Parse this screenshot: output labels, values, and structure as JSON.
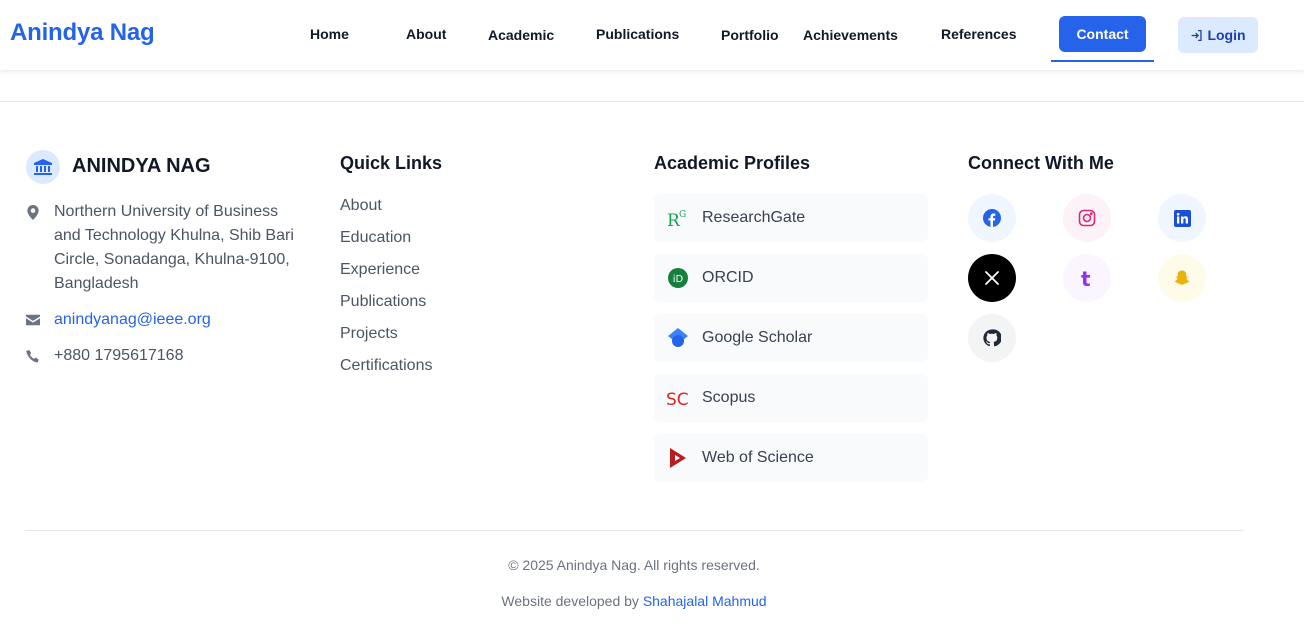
{
  "header": {
    "brand": "Anindya Nag",
    "nav": [
      "Home",
      "About",
      "Academic",
      "Publications",
      "Portfolio",
      "Achievements",
      "References"
    ],
    "contact": "Contact",
    "login": "Login"
  },
  "org": {
    "name": "ANINDYA NAG",
    "address": "Northern University of Business and Technology Khulna, Shib Bari Circle, Sonadanga, Khulna-9100, Bangladesh",
    "email": "anindyanag@ieee.org",
    "phone": "+880 1795617168"
  },
  "quick_links": {
    "heading": "Quick Links",
    "items": [
      "About",
      "Education",
      "Experience",
      "Publications",
      "Projects",
      "Certifications"
    ]
  },
  "profiles": {
    "heading": "Academic Profiles",
    "items": [
      "ResearchGate",
      "ORCID",
      "Google Scholar",
      "Scopus",
      "Web of Science"
    ]
  },
  "social": {
    "heading": "Connect With Me",
    "icons": [
      "facebook-icon",
      "instagram-icon",
      "linkedin-icon",
      "x-icon",
      "tumblr-icon",
      "snapchat-icon",
      "github-icon"
    ]
  },
  "footer": {
    "copyright": "© 2025 Anindya Nag. All rights reserved.",
    "credit_prefix": "Website developed by",
    "credit_name": "Shahajalal Mahmud"
  },
  "colors": {
    "accent": "#2563eb",
    "text": "#111827",
    "muted": "#4b5563"
  }
}
